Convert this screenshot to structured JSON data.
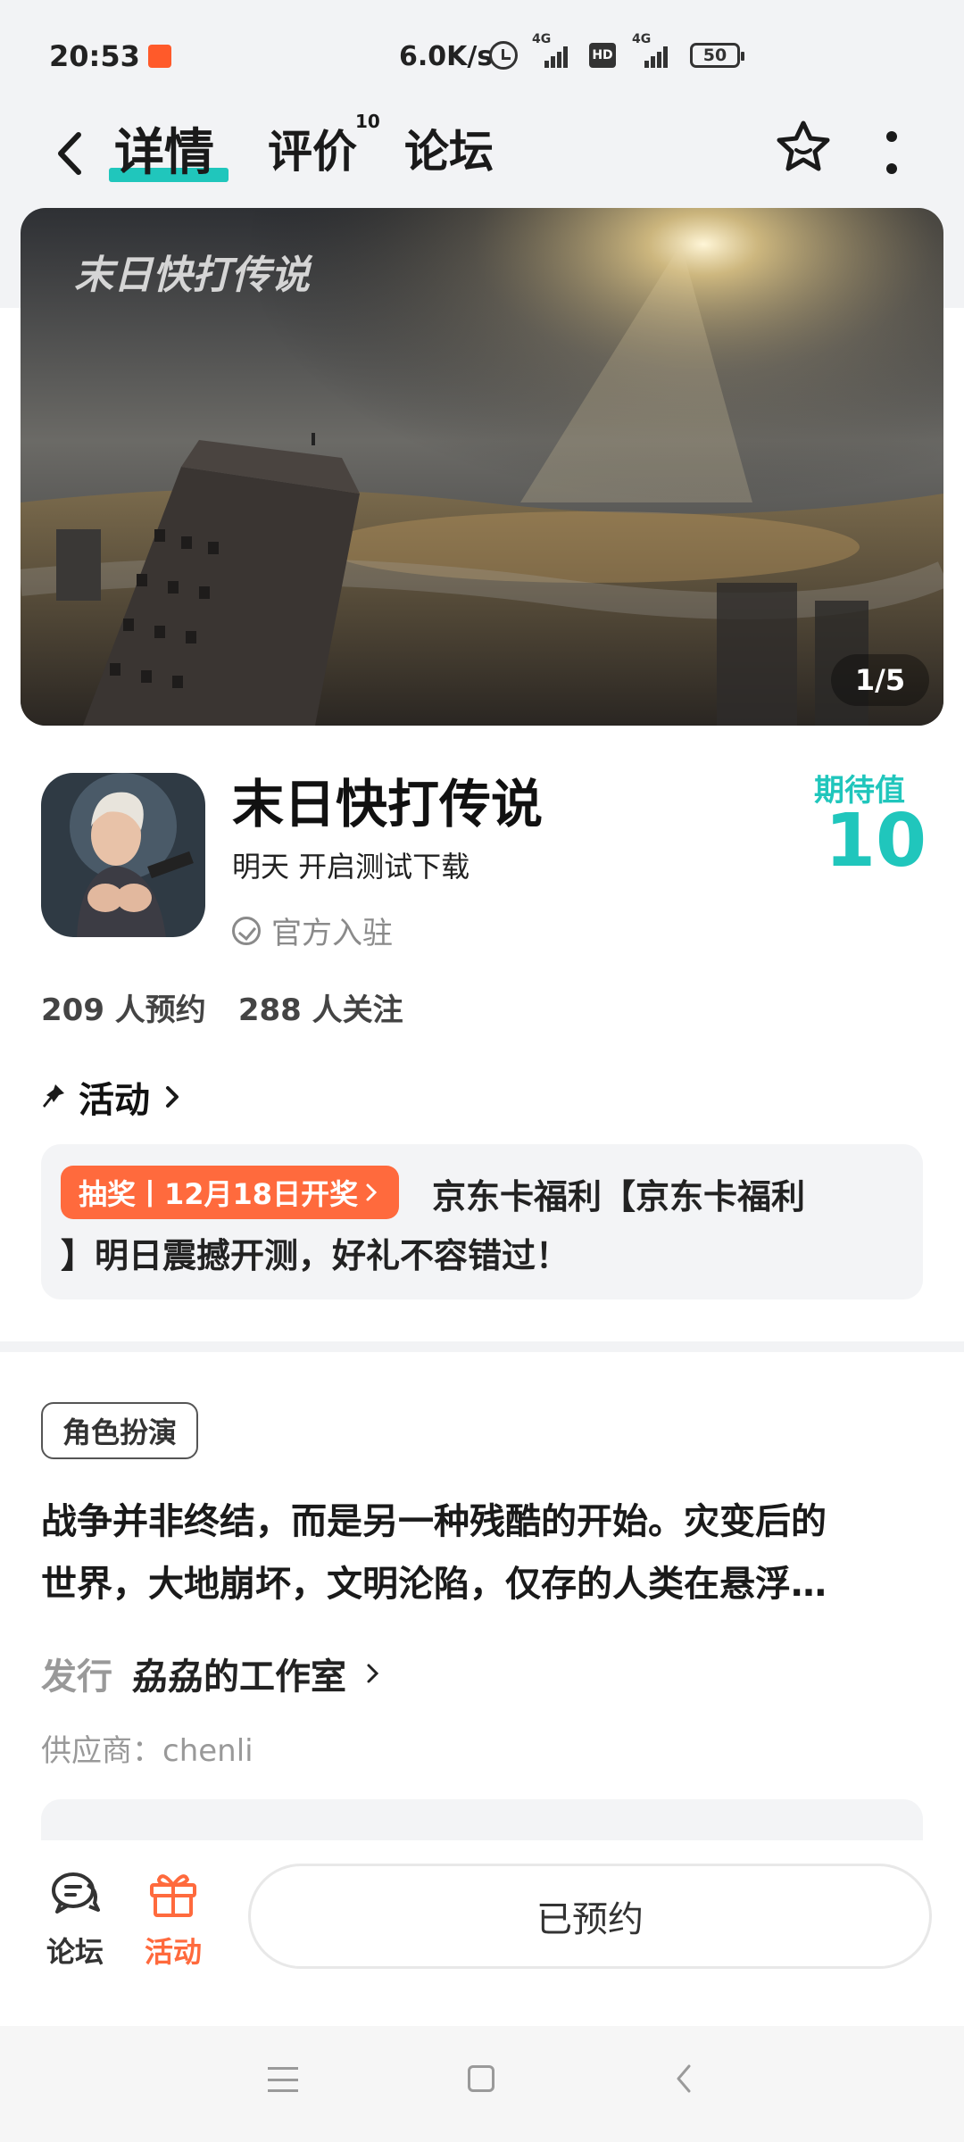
{
  "status_bar": {
    "time": "20:53",
    "network_speed": "6.0K/s",
    "signal1_label": "4G",
    "hd_label": "HD",
    "signal2_label": "4G",
    "battery": "50"
  },
  "header": {
    "tabs": [
      {
        "label": "详情",
        "active": true
      },
      {
        "label": "评价",
        "badge": "10"
      },
      {
        "label": "论坛"
      }
    ],
    "icons": [
      "back-icon",
      "star-icon",
      "more-icon"
    ]
  },
  "banner": {
    "counter": "1/5"
  },
  "game": {
    "title": "末日快打传说",
    "status": "明天 开启测试下载",
    "official": "官方入驻",
    "expect_label": "期待值",
    "expect_value": "10",
    "reservations": "209 人预约",
    "followers": "288 人关注"
  },
  "activity": {
    "heading": "活动",
    "tag": "抽奖丨12月18日开奖",
    "text_line1": "京东卡福利【京东卡福利",
    "text_line2": "】明日震撼开测，好礼不容错过！"
  },
  "description": {
    "genre": "角色扮演",
    "text_line1": "战争并非终结，而是另一种残酷的开始。灾变后的",
    "text_line2": "世界，大地崩坏，文明沦陷，仅存的人类在悬浮…",
    "publisher_label": "发行",
    "publisher_name": "劦劦的工作室",
    "supplier": "供应商：chenli"
  },
  "bottom_bar": {
    "forum_label": "论坛",
    "activity_label": "活动",
    "reserved_button": "已预约"
  },
  "colors": {
    "accent": "#20c6bc",
    "activity_orange": "#ff6a3d",
    "background": "#f2f3f5"
  }
}
